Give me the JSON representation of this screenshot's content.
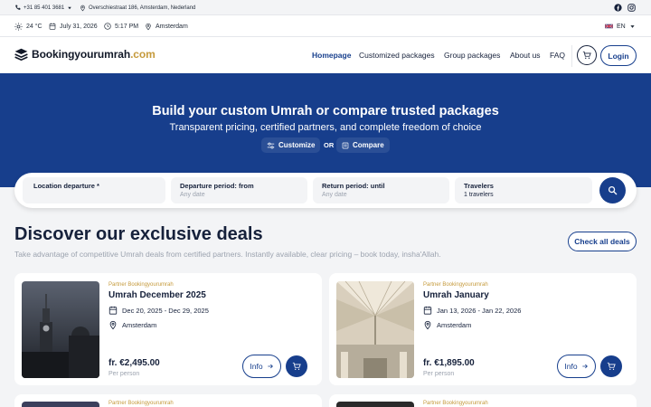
{
  "topbar": {
    "phone": "+31 85 401 3681",
    "address": "Overschiestraat 186, Amsterdam, Nederland",
    "social": [
      "facebook-icon",
      "instagram-icon"
    ]
  },
  "infobar": {
    "temperature": "24 °C",
    "date": "July 31, 2026",
    "time": "5:17 PM",
    "location": "Amsterdam",
    "language": "EN"
  },
  "brand": {
    "name": "Bookingyourumrah",
    "tld": ".com",
    "accent": "#c59a3c",
    "primary": "#173e8c"
  },
  "nav": {
    "items": [
      {
        "label": "Homepage",
        "active": true
      },
      {
        "label": "Customized packages",
        "active": false
      },
      {
        "label": "Group packages",
        "active": false
      },
      {
        "label": "About us",
        "active": false
      },
      {
        "label": "FAQ",
        "active": false
      }
    ],
    "login": "Login"
  },
  "hero": {
    "title": "Build your custom Umrah or compare trusted packages",
    "subtitle": "Transparent pricing, certified partners, and complete freedom of choice",
    "customize": "Customize",
    "or": "OR",
    "compare": "Compare"
  },
  "search": {
    "fields": [
      {
        "label": "Location departure *",
        "value": ""
      },
      {
        "label": "Departure period: from",
        "value": "Any date"
      },
      {
        "label": "Return period: until",
        "value": "Any date"
      },
      {
        "label": "Travelers",
        "value": "1 travelers"
      }
    ]
  },
  "deals": {
    "title": "Discover our exclusive deals",
    "subtitle": "Take advantage of competitive Umrah deals from certified partners. Instantly available, clear pricing – book today, insha'Allah.",
    "check_all": "Check all deals",
    "cards": [
      {
        "partner": "Partner Bookingyourumrah",
        "title": "Umrah December 2025",
        "dates": "Dec 20, 2025 - Dec 29, 2025",
        "city": "Amsterdam",
        "price": "fr. €2,495.00",
        "per": "Per person",
        "info": "Info"
      },
      {
        "partner": "Partner Bookingyourumrah",
        "title": "Umrah January",
        "dates": "Jan 13, 2026 - Jan 22, 2026",
        "city": "Amsterdam",
        "price": "fr. €1,895.00",
        "per": "Per person",
        "info": "Info"
      }
    ],
    "more": [
      {
        "partner": "Partner Bookingyourumrah"
      },
      {
        "partner": "Partner Bookingyourumrah"
      }
    ]
  }
}
